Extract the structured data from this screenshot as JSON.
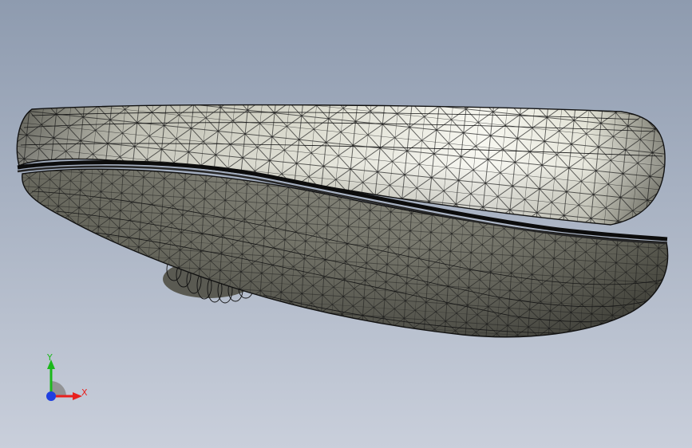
{
  "viewport": {
    "background_top": "#8E9BAF",
    "background_bottom": "#C9CFDB"
  },
  "model": {
    "shade_dark": "#3F3F38",
    "shade_mid": "#8C8C80",
    "shade_light": "#F4F4EA",
    "wire_color": "#151515"
  },
  "triad": {
    "x_label": "X",
    "y_label": "Y",
    "x_color": "#E8201E",
    "y_color": "#1BB81B",
    "z_color": "#1F3FE0"
  }
}
